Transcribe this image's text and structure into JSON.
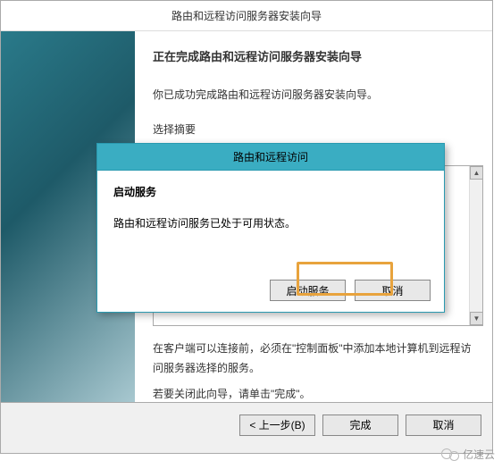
{
  "wizard": {
    "title": "路由和远程访问服务器安装向导",
    "heading": "正在完成路由和远程访问服务器安装向导",
    "success_line": "你已成功完成路由和远程访问服务器安装向导。",
    "summary_prefix": "选择摘要",
    "after_text_1": "在客户端可以连接前，必须在\"控制面板\"中添加本地计算机到远程访问服务器选择的服务。",
    "after_text_2": "若要关闭此向导，请单击\"完成\"。",
    "footer": {
      "back": "< 上一步(B)",
      "finish": "完成",
      "cancel": "取消"
    }
  },
  "dialog": {
    "title": "路由和远程访问",
    "heading": "启动服务",
    "text": "路由和远程访问服务已处于可用状态。",
    "start_button": "启动服务",
    "cancel_button": "取消"
  },
  "watermark": "亿速云"
}
